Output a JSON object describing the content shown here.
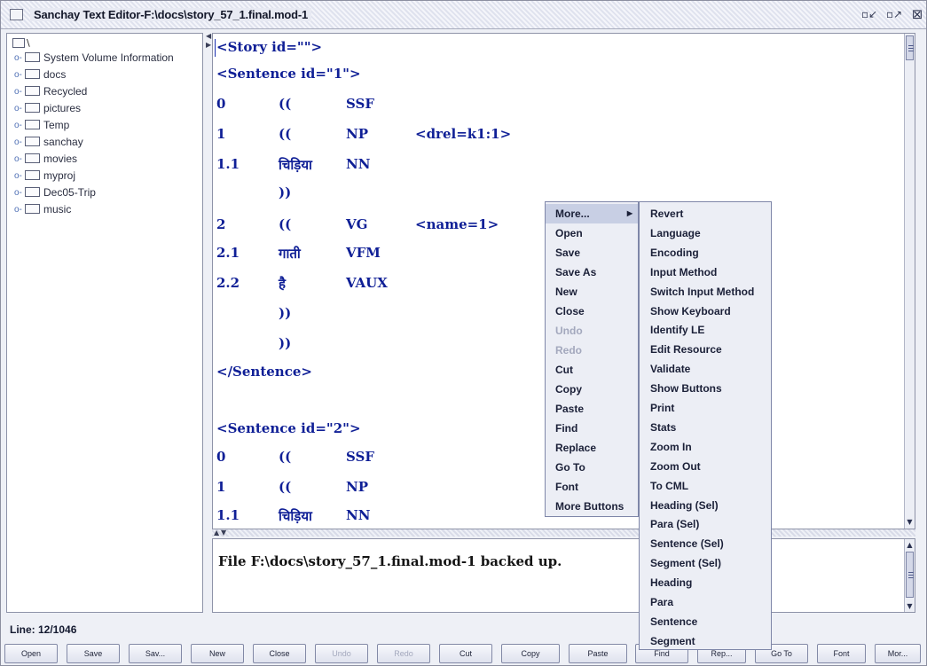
{
  "window": {
    "title": "Sanchay Text Editor-F:\\docs\\story_57_1.final.mod-1",
    "min_glyph": "▫↙",
    "max_glyph": "▫↗",
    "close_glyph": "⊠"
  },
  "tree": {
    "root_label": "\\",
    "items": [
      {
        "label": "System Volume Information"
      },
      {
        "label": "docs"
      },
      {
        "label": "Recycled"
      },
      {
        "label": "pictures"
      },
      {
        "label": "Temp"
      },
      {
        "label": "sanchay"
      },
      {
        "label": "movies"
      },
      {
        "label": "myproj"
      },
      {
        "label": "Dec05-Trip"
      },
      {
        "label": "music"
      }
    ]
  },
  "editor": {
    "lines": [
      {
        "c1": "<Story id=\"\">",
        "c2": "",
        "c3": "",
        "c4": ""
      },
      {
        "c1": "<Sentence id=\"1\">",
        "c2": "",
        "c3": "",
        "c4": ""
      },
      {
        "c1": "0",
        "c2": "((",
        "c3": "SSF",
        "c4": ""
      },
      {
        "c1": "1",
        "c2": "((",
        "c3": "NP",
        "c4": "<drel=k1:1>"
      },
      {
        "c1": "1.1",
        "c2": "चिड़िया",
        "c3": "NN",
        "c4": ""
      },
      {
        "c1": "",
        "c2": "))",
        "c3": "",
        "c4": ""
      },
      {
        "c1": "2",
        "c2": "((",
        "c3": "VG",
        "c4": "<name=1>"
      },
      {
        "c1": "2.1",
        "c2": "गाती",
        "c3": "VFM",
        "c4": ""
      },
      {
        "c1": "2.2",
        "c2": "है",
        "c3": "VAUX",
        "c4": ""
      },
      {
        "c1": "",
        "c2": "))",
        "c3": "",
        "c4": ""
      },
      {
        "c1": "",
        "c2": "))",
        "c3": "",
        "c4": ""
      },
      {
        "c1": "</Sentence>",
        "c2": "",
        "c3": "",
        "c4": ""
      },
      {
        "c1": "",
        "c2": "",
        "c3": "",
        "c4": ""
      },
      {
        "c1": "<Sentence id=\"2\">",
        "c2": "",
        "c3": "",
        "c4": ""
      },
      {
        "c1": "0",
        "c2": "((",
        "c3": "SSF",
        "c4": ""
      },
      {
        "c1": "1",
        "c2": "((",
        "c3": "NP",
        "c4": ""
      },
      {
        "c1": "1.1",
        "c2": "चिड़िया",
        "c3": "NN",
        "c4": ""
      }
    ]
  },
  "log": {
    "message": "File F:\\docs\\story_57_1.final.mod-1 backed up."
  },
  "status": {
    "line_label": "Line: 12/1046"
  },
  "context_menu": {
    "items": [
      {
        "label": "More...",
        "has_submenu": true,
        "disabled": false
      },
      {
        "label": "Open",
        "disabled": false
      },
      {
        "label": "Save",
        "disabled": false
      },
      {
        "label": "Save As",
        "disabled": false
      },
      {
        "label": "New",
        "disabled": false
      },
      {
        "label": "Close",
        "disabled": false
      },
      {
        "label": "Undo",
        "disabled": true
      },
      {
        "label": "Redo",
        "disabled": true
      },
      {
        "label": "Cut",
        "disabled": false
      },
      {
        "label": "Copy",
        "disabled": false
      },
      {
        "label": "Paste",
        "disabled": false
      },
      {
        "label": "Find",
        "disabled": false
      },
      {
        "label": "Replace",
        "disabled": false
      },
      {
        "label": "Go To",
        "disabled": false
      },
      {
        "label": "Font",
        "disabled": false
      },
      {
        "label": "More Buttons",
        "disabled": false
      }
    ],
    "submenu_arrow": "▶"
  },
  "submenu": {
    "items": [
      {
        "label": "Revert"
      },
      {
        "label": "Language"
      },
      {
        "label": "Encoding"
      },
      {
        "label": "Input Method"
      },
      {
        "label": "Switch Input Method"
      },
      {
        "label": "Show Keyboard"
      },
      {
        "label": "Identify LE"
      },
      {
        "label": "Edit Resource"
      },
      {
        "label": "Validate"
      },
      {
        "label": "Show Buttons"
      },
      {
        "label": "Print"
      },
      {
        "label": "Stats"
      },
      {
        "label": "Zoom In"
      },
      {
        "label": "Zoom Out"
      },
      {
        "label": "To CML"
      },
      {
        "label": "Heading (Sel)"
      },
      {
        "label": "Para (Sel)"
      },
      {
        "label": "Sentence (Sel)"
      },
      {
        "label": "Segment (Sel)"
      },
      {
        "label": "Heading"
      },
      {
        "label": "Para"
      },
      {
        "label": "Sentence"
      },
      {
        "label": "Segment"
      }
    ]
  },
  "toolbar": {
    "buttons": [
      {
        "label": "Open",
        "disabled": false
      },
      {
        "label": "Save",
        "disabled": false
      },
      {
        "label": "Sav...",
        "disabled": false
      },
      {
        "label": "New",
        "disabled": false
      },
      {
        "label": "Close",
        "disabled": false
      },
      {
        "label": "Undo",
        "disabled": true
      },
      {
        "label": "Redo",
        "disabled": true
      },
      {
        "label": "Cut",
        "disabled": false
      },
      {
        "label": "Copy",
        "disabled": false
      },
      {
        "label": "Paste",
        "disabled": false
      },
      {
        "label": "Find",
        "disabled": false
      },
      {
        "label": "Rep...",
        "disabled": false
      },
      {
        "label": "Go To",
        "disabled": false
      },
      {
        "label": "Font",
        "disabled": false
      },
      {
        "label": "Mor...",
        "disabled": false
      }
    ]
  }
}
